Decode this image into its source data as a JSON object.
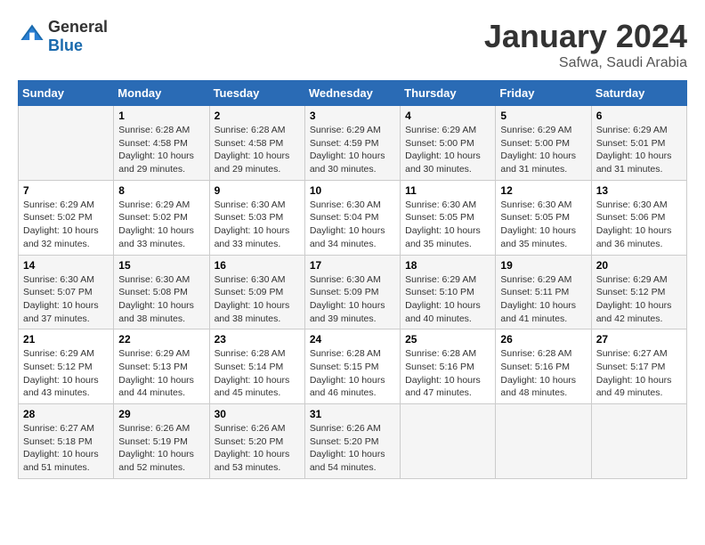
{
  "header": {
    "logo_line1": "General",
    "logo_line2": "Blue",
    "month_year": "January 2024",
    "location": "Safwa, Saudi Arabia"
  },
  "days_of_week": [
    "Sunday",
    "Monday",
    "Tuesday",
    "Wednesday",
    "Thursday",
    "Friday",
    "Saturday"
  ],
  "weeks": [
    [
      {
        "day": "",
        "info": ""
      },
      {
        "day": "1",
        "info": "Sunrise: 6:28 AM\nSunset: 4:58 PM\nDaylight: 10 hours\nand 29 minutes."
      },
      {
        "day": "2",
        "info": "Sunrise: 6:28 AM\nSunset: 4:58 PM\nDaylight: 10 hours\nand 29 minutes."
      },
      {
        "day": "3",
        "info": "Sunrise: 6:29 AM\nSunset: 4:59 PM\nDaylight: 10 hours\nand 30 minutes."
      },
      {
        "day": "4",
        "info": "Sunrise: 6:29 AM\nSunset: 5:00 PM\nDaylight: 10 hours\nand 30 minutes."
      },
      {
        "day": "5",
        "info": "Sunrise: 6:29 AM\nSunset: 5:00 PM\nDaylight: 10 hours\nand 31 minutes."
      },
      {
        "day": "6",
        "info": "Sunrise: 6:29 AM\nSunset: 5:01 PM\nDaylight: 10 hours\nand 31 minutes."
      }
    ],
    [
      {
        "day": "7",
        "info": "Sunrise: 6:29 AM\nSunset: 5:02 PM\nDaylight: 10 hours\nand 32 minutes."
      },
      {
        "day": "8",
        "info": "Sunrise: 6:29 AM\nSunset: 5:02 PM\nDaylight: 10 hours\nand 33 minutes."
      },
      {
        "day": "9",
        "info": "Sunrise: 6:30 AM\nSunset: 5:03 PM\nDaylight: 10 hours\nand 33 minutes."
      },
      {
        "day": "10",
        "info": "Sunrise: 6:30 AM\nSunset: 5:04 PM\nDaylight: 10 hours\nand 34 minutes."
      },
      {
        "day": "11",
        "info": "Sunrise: 6:30 AM\nSunset: 5:05 PM\nDaylight: 10 hours\nand 35 minutes."
      },
      {
        "day": "12",
        "info": "Sunrise: 6:30 AM\nSunset: 5:05 PM\nDaylight: 10 hours\nand 35 minutes."
      },
      {
        "day": "13",
        "info": "Sunrise: 6:30 AM\nSunset: 5:06 PM\nDaylight: 10 hours\nand 36 minutes."
      }
    ],
    [
      {
        "day": "14",
        "info": "Sunrise: 6:30 AM\nSunset: 5:07 PM\nDaylight: 10 hours\nand 37 minutes."
      },
      {
        "day": "15",
        "info": "Sunrise: 6:30 AM\nSunset: 5:08 PM\nDaylight: 10 hours\nand 38 minutes."
      },
      {
        "day": "16",
        "info": "Sunrise: 6:30 AM\nSunset: 5:09 PM\nDaylight: 10 hours\nand 38 minutes."
      },
      {
        "day": "17",
        "info": "Sunrise: 6:30 AM\nSunset: 5:09 PM\nDaylight: 10 hours\nand 39 minutes."
      },
      {
        "day": "18",
        "info": "Sunrise: 6:29 AM\nSunset: 5:10 PM\nDaylight: 10 hours\nand 40 minutes."
      },
      {
        "day": "19",
        "info": "Sunrise: 6:29 AM\nSunset: 5:11 PM\nDaylight: 10 hours\nand 41 minutes."
      },
      {
        "day": "20",
        "info": "Sunrise: 6:29 AM\nSunset: 5:12 PM\nDaylight: 10 hours\nand 42 minutes."
      }
    ],
    [
      {
        "day": "21",
        "info": "Sunrise: 6:29 AM\nSunset: 5:12 PM\nDaylight: 10 hours\nand 43 minutes."
      },
      {
        "day": "22",
        "info": "Sunrise: 6:29 AM\nSunset: 5:13 PM\nDaylight: 10 hours\nand 44 minutes."
      },
      {
        "day": "23",
        "info": "Sunrise: 6:28 AM\nSunset: 5:14 PM\nDaylight: 10 hours\nand 45 minutes."
      },
      {
        "day": "24",
        "info": "Sunrise: 6:28 AM\nSunset: 5:15 PM\nDaylight: 10 hours\nand 46 minutes."
      },
      {
        "day": "25",
        "info": "Sunrise: 6:28 AM\nSunset: 5:16 PM\nDaylight: 10 hours\nand 47 minutes."
      },
      {
        "day": "26",
        "info": "Sunrise: 6:28 AM\nSunset: 5:16 PM\nDaylight: 10 hours\nand 48 minutes."
      },
      {
        "day": "27",
        "info": "Sunrise: 6:27 AM\nSunset: 5:17 PM\nDaylight: 10 hours\nand 49 minutes."
      }
    ],
    [
      {
        "day": "28",
        "info": "Sunrise: 6:27 AM\nSunset: 5:18 PM\nDaylight: 10 hours\nand 51 minutes."
      },
      {
        "day": "29",
        "info": "Sunrise: 6:26 AM\nSunset: 5:19 PM\nDaylight: 10 hours\nand 52 minutes."
      },
      {
        "day": "30",
        "info": "Sunrise: 6:26 AM\nSunset: 5:20 PM\nDaylight: 10 hours\nand 53 minutes."
      },
      {
        "day": "31",
        "info": "Sunrise: 6:26 AM\nSunset: 5:20 PM\nDaylight: 10 hours\nand 54 minutes."
      },
      {
        "day": "",
        "info": ""
      },
      {
        "day": "",
        "info": ""
      },
      {
        "day": "",
        "info": ""
      }
    ]
  ]
}
